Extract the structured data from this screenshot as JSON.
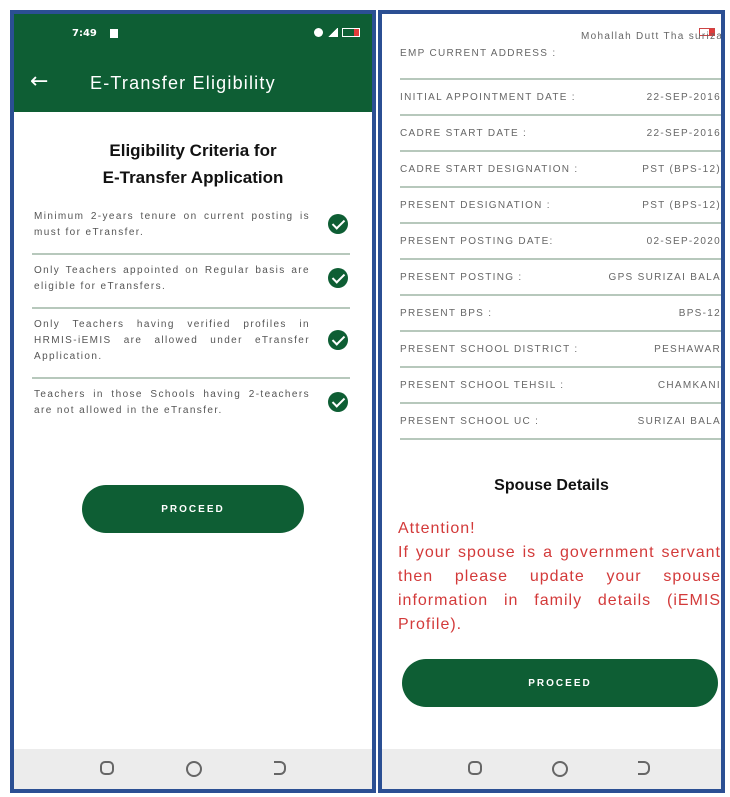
{
  "left": {
    "status": {
      "time": "7:49"
    },
    "appbar": {
      "back_icon": "arrow-left-icon",
      "title": "E-Transfer Eligibility"
    },
    "heading": {
      "line1": "Eligibility Criteria for",
      "line2": "E-Transfer Application"
    },
    "criteria": [
      {
        "text": "Minimum 2-years tenure on current posting is must for eTransfer."
      },
      {
        "text": "Only Teachers appointed on Regular basis are eligible for eTransfers."
      },
      {
        "text": "Only Teachers having verified profiles in HRMIS-iEMIS are allowed under eTransfer Application."
      },
      {
        "text": "Teachers in those Schools having 2-teachers are not allowed in the eTransfer."
      }
    ],
    "proceed_label": "PROCEED"
  },
  "right": {
    "address": {
      "label": "EMP CURRENT ADDRESS :",
      "value": "Mohallah Dutt Tha surizai bala Peshawar"
    },
    "rows": [
      {
        "label": "INITIAL APPOINTMENT DATE :",
        "value": "22-SEP-2016"
      },
      {
        "label": "CADRE START DATE :",
        "value": "22-SEP-2016"
      },
      {
        "label": "CADRE START DESIGNATION :",
        "value": "PST (BPS-12)"
      },
      {
        "label": "PRESENT DESIGNATION :",
        "value": "PST (BPS-12)"
      },
      {
        "label": "PRESENT POSTING DATE:",
        "value": "02-SEP-2020"
      },
      {
        "label": "PRESENT POSTING :",
        "value": "GPS SURIZAI BALA"
      },
      {
        "label": "PRESENT BPS :",
        "value": "BPS-12"
      },
      {
        "label": "PRESENT SCHOOL DISTRICT :",
        "value": "PESHAWAR"
      },
      {
        "label": "PRESENT SCHOOL TEHSIL :",
        "value": "CHAMKANI"
      },
      {
        "label": "PRESENT SCHOOL UC :",
        "value": "SURIZAI BALA"
      }
    ],
    "spouse_heading": "Spouse Details",
    "attention_title": "Attention!",
    "attention_text": "If your spouse is a government servant then please update your spouse information in family details (iEMIS Profile).",
    "proceed_label": "PROCEED"
  },
  "colors": {
    "brand_green": "#0e5e34",
    "attention_red": "#d33a3a",
    "divider": "#b7c8bc",
    "frame_blue": "#2b4f93"
  }
}
